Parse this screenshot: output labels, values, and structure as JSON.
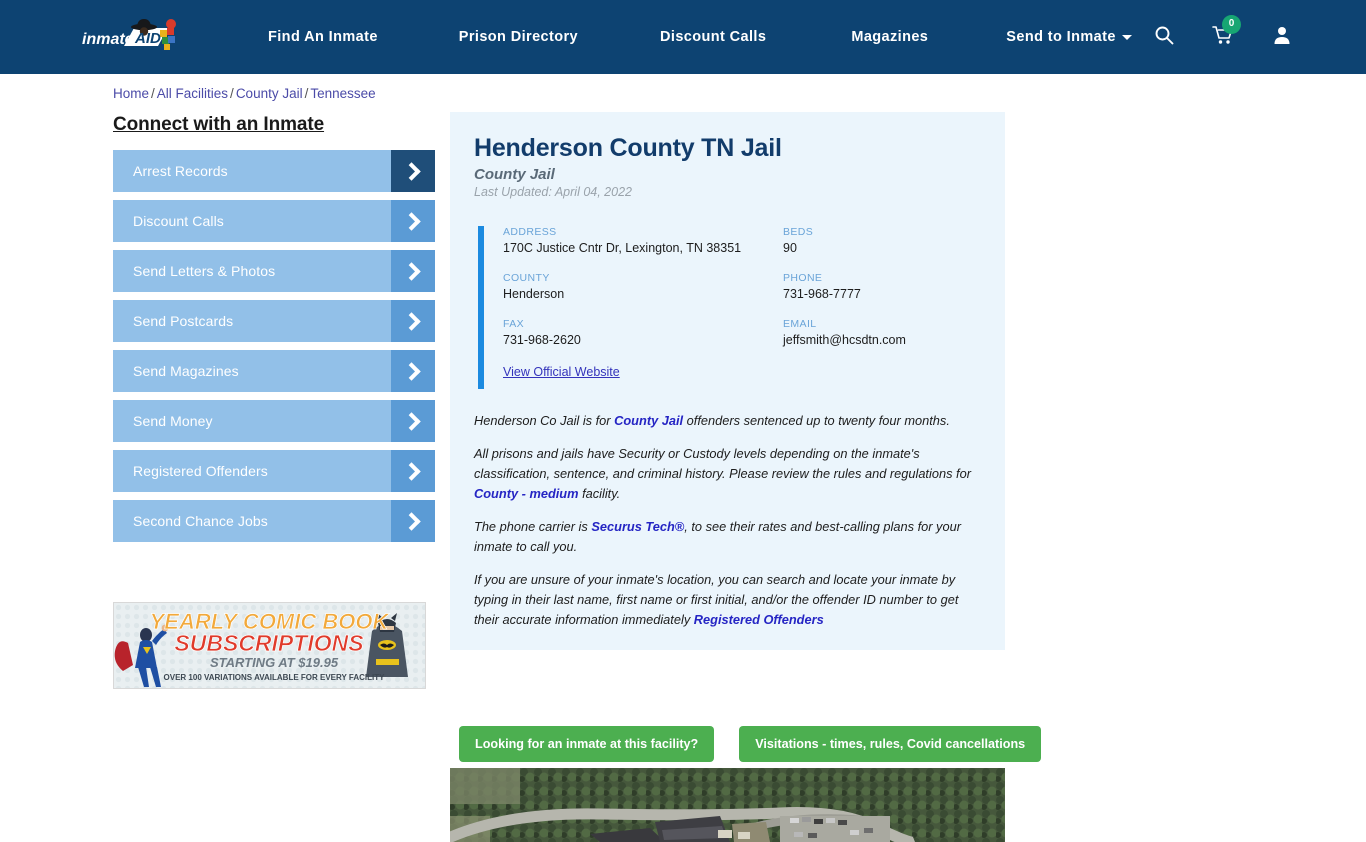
{
  "header": {
    "logo_text": "inmateAID",
    "nav": [
      {
        "label": "Find An Inmate"
      },
      {
        "label": "Prison Directory"
      },
      {
        "label": "Discount Calls"
      },
      {
        "label": "Magazines"
      },
      {
        "label": "Send to Inmate"
      }
    ],
    "icons": {
      "search": "search-icon",
      "cart": "shopping-cart-icon",
      "account": "user-account-icon"
    },
    "cart_count": "0",
    "brand_color": "#0d4372",
    "badge_color": "#17a673"
  },
  "breadcrumb": {
    "items": [
      "Home",
      "All Facilities",
      "County Jail",
      "Tennessee"
    ],
    "separator": "/"
  },
  "sidebar": {
    "title": "Connect with an Inmate",
    "items": [
      {
        "label": "Arrest Records",
        "active": true
      },
      {
        "label": "Discount Calls",
        "active": false
      },
      {
        "label": "Send Letters & Photos",
        "active": false
      },
      {
        "label": "Send Postcards",
        "active": false
      },
      {
        "label": "Send Magazines",
        "active": false
      },
      {
        "label": "Send Money",
        "active": false
      },
      {
        "label": "Registered Offenders",
        "active": false
      },
      {
        "label": "Second Chance Jobs",
        "active": false
      }
    ],
    "ad": {
      "line1": "YEARLY COMIC BOOK",
      "line2": "SUBSCRIPTIONS",
      "line3": "STARTING AT $19.95",
      "line4": "OVER 100 VARIATIONS AVAILABLE FOR EVERY FACILITY"
    }
  },
  "facility": {
    "title": "Henderson County TN Jail",
    "subtitle": "County Jail",
    "last_updated": "Last Updated: April 04, 2022",
    "fields": [
      {
        "label": "ADDRESS",
        "value": "170C Justice Cntr Dr, Lexington, TN 38351"
      },
      {
        "label": "BEDS",
        "value": "90"
      },
      {
        "label": "COUNTY",
        "value": "Henderson"
      },
      {
        "label": "PHONE",
        "value": "731-968-7777"
      },
      {
        "label": "FAX",
        "value": "731-968-2620"
      },
      {
        "label": "EMAIL",
        "value": "jeffsmith@hcsdtn.com"
      }
    ],
    "official_website_label": "View Official Website",
    "accent_color": "#1b8ae0",
    "card_bg": "#ebf5fc"
  },
  "description": {
    "p1_a": "Henderson Co Jail is for ",
    "p1_link": "County Jail",
    "p1_b": " offenders sentenced up to twenty four months.",
    "p2_a": "All prisons and jails have Security or Custody levels depending on the inmate's classification, sentence, and criminal history. Please review the rules and regulations for ",
    "p2_link": "County - medium",
    "p2_b": " facility.",
    "p3_a": "The phone carrier is ",
    "p3_link": "Securus Tech®",
    "p3_b": ", to see their rates and best-calling plans for your inmate to call you.",
    "p4_a": "If you are unsure of your inmate's location, you can search and locate your inmate by typing in their last name, first name or first initial, and/or the offender ID number to get their accurate information immediately ",
    "p4_link": "Registered Offenders"
  },
  "cta": {
    "primary": "Looking for an inmate at this facility?",
    "secondary": "Visitations - times, rules, Covid cancellations",
    "color": "#4caf50"
  },
  "map": {
    "alt": "satellite-aerial-view-of-facility"
  }
}
